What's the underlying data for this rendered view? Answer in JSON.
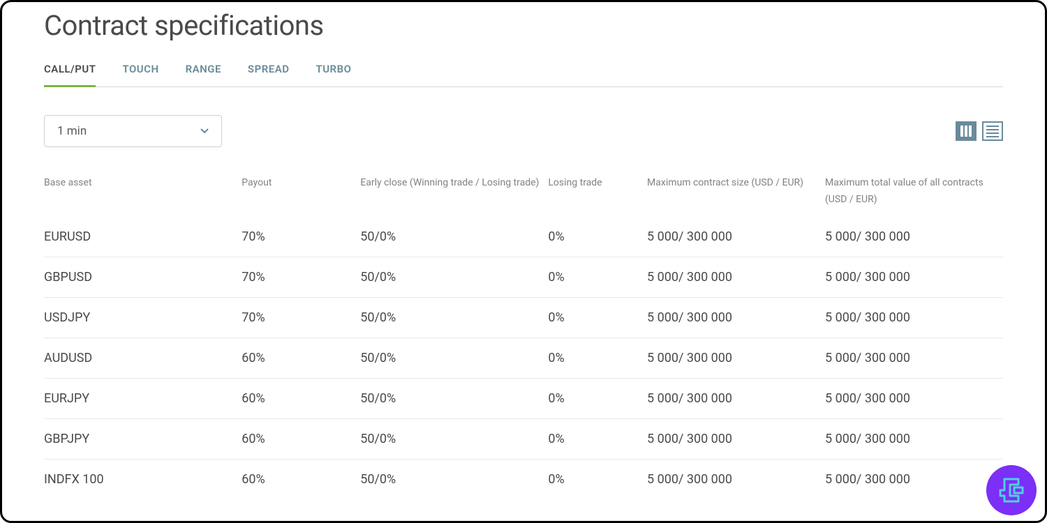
{
  "page": {
    "title": "Contract specifications"
  },
  "tabs": [
    {
      "label": "CALL/PUT",
      "active": true
    },
    {
      "label": "TOUCH",
      "active": false
    },
    {
      "label": "RANGE",
      "active": false
    },
    {
      "label": "SPREAD",
      "active": false
    },
    {
      "label": "TURBO",
      "active": false
    }
  ],
  "dropdown": {
    "selected": "1 min"
  },
  "table": {
    "headers": {
      "asset": "Base asset",
      "payout": "Payout",
      "early_close": "Early close (Winning trade / Losing trade)",
      "losing": "Losing trade",
      "max_size": "Maximum contract size (USD / EUR)",
      "max_total": "Maximum total value of all contracts (USD / EUR)"
    },
    "rows": [
      {
        "asset": "EURUSD",
        "payout": "70%",
        "early_close": "50/0%",
        "losing": "0%",
        "max_size": "5 000/ 300 000",
        "max_total": "5 000/ 300 000"
      },
      {
        "asset": "GBPUSD",
        "payout": "70%",
        "early_close": "50/0%",
        "losing": "0%",
        "max_size": "5 000/ 300 000",
        "max_total": "5 000/ 300 000"
      },
      {
        "asset": "USDJPY",
        "payout": "70%",
        "early_close": "50/0%",
        "losing": "0%",
        "max_size": "5 000/ 300 000",
        "max_total": "5 000/ 300 000"
      },
      {
        "asset": "AUDUSD",
        "payout": "60%",
        "early_close": "50/0%",
        "losing": "0%",
        "max_size": "5 000/ 300 000",
        "max_total": "5 000/ 300 000"
      },
      {
        "asset": "EURJPY",
        "payout": "60%",
        "early_close": "50/0%",
        "losing": "0%",
        "max_size": "5 000/ 300 000",
        "max_total": "5 000/ 300 000"
      },
      {
        "asset": "GBPJPY",
        "payout": "60%",
        "early_close": "50/0%",
        "losing": "0%",
        "max_size": "5 000/ 300 000",
        "max_total": "5 000/ 300 000"
      },
      {
        "asset": "INDFX 100",
        "payout": "60%",
        "early_close": "50/0%",
        "losing": "0%",
        "max_size": "5 000/ 300 000",
        "max_total": "5 000/ 300 000"
      }
    ]
  }
}
